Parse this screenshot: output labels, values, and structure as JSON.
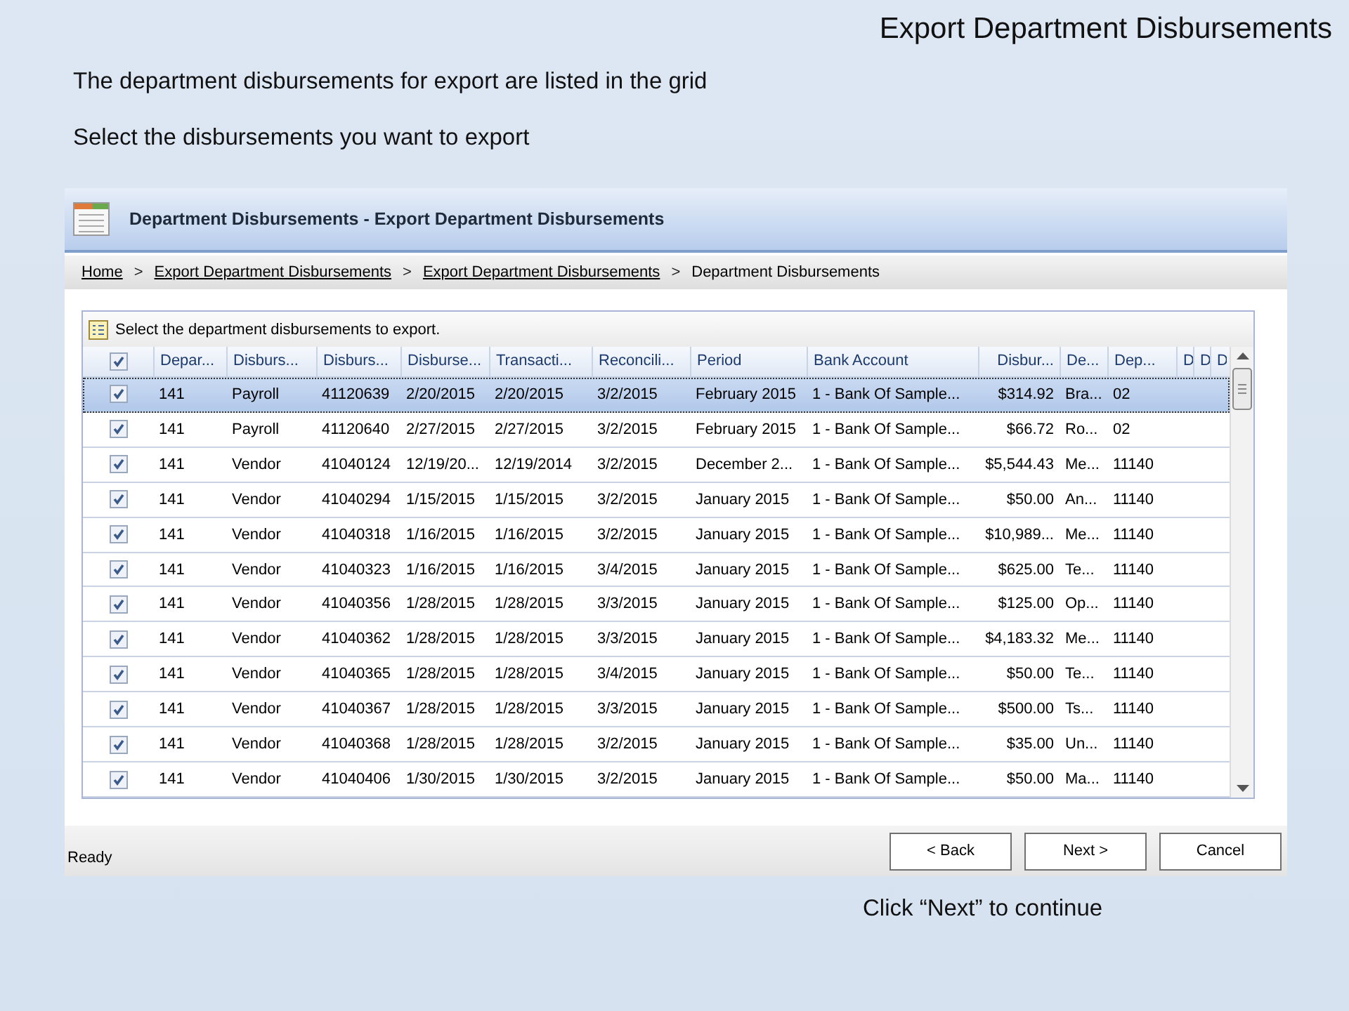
{
  "slide": {
    "title": "Export Department Disbursements",
    "lines": [
      "The department disbursements for export are listed in the grid",
      "Select the disbursements you want to export"
    ],
    "footer": "Click “Next” to continue"
  },
  "window": {
    "title": "Department Disbursements - Export Department Disbursements",
    "breadcrumb": {
      "separator": ">",
      "items": [
        {
          "label": "Home",
          "kind": "link"
        },
        {
          "label": "Export Department Disbursements",
          "kind": "link"
        },
        {
          "label": "Export Department Disbursements",
          "kind": "link"
        },
        {
          "label": "Department Disbursements",
          "kind": "current"
        }
      ]
    },
    "panel_title": "Select the department disbursements to export.",
    "table": {
      "all_checked": true,
      "columns": [
        "Depar...",
        "Disburs...",
        "Disburs...",
        "Disburse...",
        "Transacti...",
        "Reconcili...",
        "Period",
        "Bank Account",
        "Disbur...",
        "De...",
        "Dep...",
        "D",
        "D",
        "D"
      ],
      "rows": [
        {
          "checked": true,
          "selected": true,
          "cells": [
            "141",
            "Payroll",
            "41120639",
            "2/20/2015",
            "2/20/2015",
            "3/2/2015",
            "February 2015",
            "1 - Bank Of Sample...",
            "$314.92",
            "Bra...",
            "02"
          ]
        },
        {
          "checked": true,
          "selected": false,
          "cells": [
            "141",
            "Payroll",
            "41120640",
            "2/27/2015",
            "2/27/2015",
            "3/2/2015",
            "February 2015",
            "1 - Bank Of Sample...",
            "$66.72",
            "Ro...",
            "02"
          ]
        },
        {
          "checked": true,
          "selected": false,
          "cells": [
            "141",
            "Vendor",
            "41040124",
            "12/19/20...",
            "12/19/2014",
            "3/2/2015",
            "December 2...",
            "1 - Bank Of Sample...",
            "$5,544.43",
            "Me...",
            "11140"
          ]
        },
        {
          "checked": true,
          "selected": false,
          "cells": [
            "141",
            "Vendor",
            "41040294",
            "1/15/2015",
            "1/15/2015",
            "3/2/2015",
            "January 2015",
            "1 - Bank Of Sample...",
            "$50.00",
            "An...",
            "11140"
          ]
        },
        {
          "checked": true,
          "selected": false,
          "cells": [
            "141",
            "Vendor",
            "41040318",
            "1/16/2015",
            "1/16/2015",
            "3/2/2015",
            "January 2015",
            "1 - Bank Of Sample...",
            "$10,989...",
            "Me...",
            "11140"
          ]
        },
        {
          "checked": true,
          "selected": false,
          "cells": [
            "141",
            "Vendor",
            "41040323",
            "1/16/2015",
            "1/16/2015",
            "3/4/2015",
            "January 2015",
            "1 - Bank Of Sample...",
            "$625.00",
            "Te...",
            "11140"
          ]
        },
        {
          "checked": true,
          "selected": false,
          "cells": [
            "141",
            "Vendor",
            "41040356",
            "1/28/2015",
            "1/28/2015",
            "3/3/2015",
            "January 2015",
            "1 - Bank Of Sample...",
            "$125.00",
            "Op...",
            "11140"
          ]
        },
        {
          "checked": true,
          "selected": false,
          "cells": [
            "141",
            "Vendor",
            "41040362",
            "1/28/2015",
            "1/28/2015",
            "3/3/2015",
            "January 2015",
            "1 - Bank Of Sample...",
            "$4,183.32",
            "Me...",
            "11140"
          ]
        },
        {
          "checked": true,
          "selected": false,
          "cells": [
            "141",
            "Vendor",
            "41040365",
            "1/28/2015",
            "1/28/2015",
            "3/4/2015",
            "January 2015",
            "1 - Bank Of Sample...",
            "$50.00",
            "Te...",
            "11140"
          ]
        },
        {
          "checked": true,
          "selected": false,
          "cells": [
            "141",
            "Vendor",
            "41040367",
            "1/28/2015",
            "1/28/2015",
            "3/3/2015",
            "January 2015",
            "1 - Bank Of Sample...",
            "$500.00",
            "Ts...",
            "11140"
          ]
        },
        {
          "checked": true,
          "selected": false,
          "cells": [
            "141",
            "Vendor",
            "41040368",
            "1/28/2015",
            "1/28/2015",
            "3/2/2015",
            "January 2015",
            "1 - Bank Of Sample...",
            "$35.00",
            "Un...",
            "11140"
          ]
        },
        {
          "checked": true,
          "selected": false,
          "cells": [
            "141",
            "Vendor",
            "41040406",
            "1/30/2015",
            "1/30/2015",
            "3/2/2015",
            "January 2015",
            "1 - Bank Of Sample...",
            "$50.00",
            "Ma...",
            "11140"
          ]
        }
      ]
    },
    "status": "Ready",
    "buttons": [
      "< Back",
      "Next >",
      "Cancel"
    ]
  }
}
